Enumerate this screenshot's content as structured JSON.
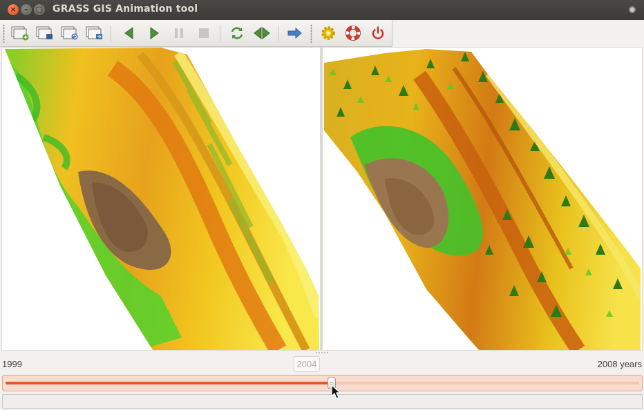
{
  "window": {
    "title": "GRASS GIS Animation tool",
    "close_glyph": "×",
    "minimize_glyph": "–",
    "maximize_glyph": "□"
  },
  "toolbar": {
    "buttons": [
      {
        "name": "add-animation-button",
        "icon": "layers-plus-icon"
      },
      {
        "name": "edit-animation-button",
        "icon": "layers-edit-icon"
      },
      {
        "name": "reload-animation-button",
        "icon": "layers-refresh-icon"
      },
      {
        "name": "export-animation-button",
        "icon": "layers-export-icon"
      },
      {
        "name": "play-back-button",
        "icon": "play-back-icon"
      },
      {
        "name": "play-button",
        "icon": "play-icon"
      },
      {
        "name": "pause-button",
        "icon": "pause-icon",
        "enabled": false
      },
      {
        "name": "stop-button",
        "icon": "stop-icon",
        "enabled": false
      },
      {
        "name": "repeat-button",
        "icon": "repeat-icon"
      },
      {
        "name": "bounce-button",
        "icon": "bounce-icon"
      },
      {
        "name": "order-button",
        "icon": "arrow-right-icon"
      },
      {
        "name": "settings-button",
        "icon": "gear-icon"
      },
      {
        "name": "help-button",
        "icon": "lifebuoy-icon"
      },
      {
        "name": "quit-button",
        "icon": "power-icon"
      }
    ]
  },
  "timeline": {
    "start_label": "1999",
    "end_label": "2008 years",
    "current_value": "2004",
    "progress": 0.515,
    "colors": {
      "accent": "#e15a26",
      "track": "#f9dccd"
    }
  },
  "statusbar": {
    "text": ""
  }
}
